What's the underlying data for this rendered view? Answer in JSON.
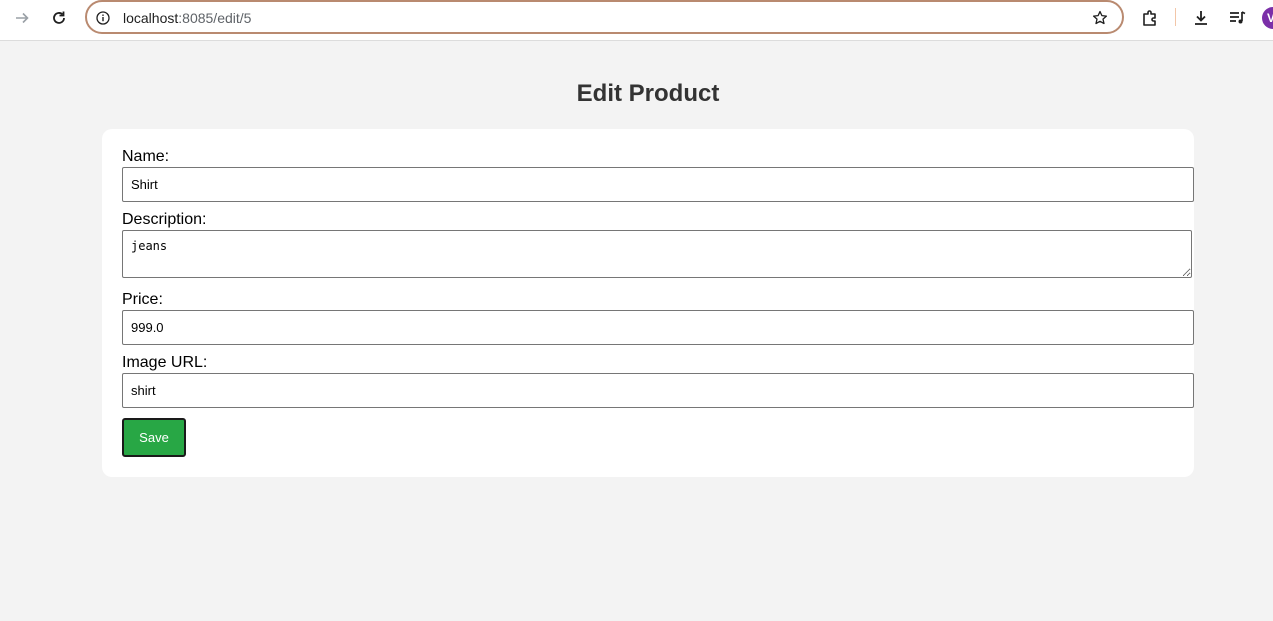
{
  "browser": {
    "url_host": "localhost",
    "url_rest": ":8085/edit/5",
    "profile_initial": "V"
  },
  "page": {
    "title": "Edit Product"
  },
  "form": {
    "name_label": "Name:",
    "name_value": "Shirt",
    "description_label": "Description:",
    "description_value": "jeans",
    "price_label": "Price:",
    "price_value": "999.0",
    "image_url_label": "Image URL:",
    "image_url_value": "shirt",
    "save_label": "Save"
  },
  "colors": {
    "save_button": "#28a745",
    "page_background": "#f3f3f3",
    "omnibox_border": "#b98a70"
  }
}
